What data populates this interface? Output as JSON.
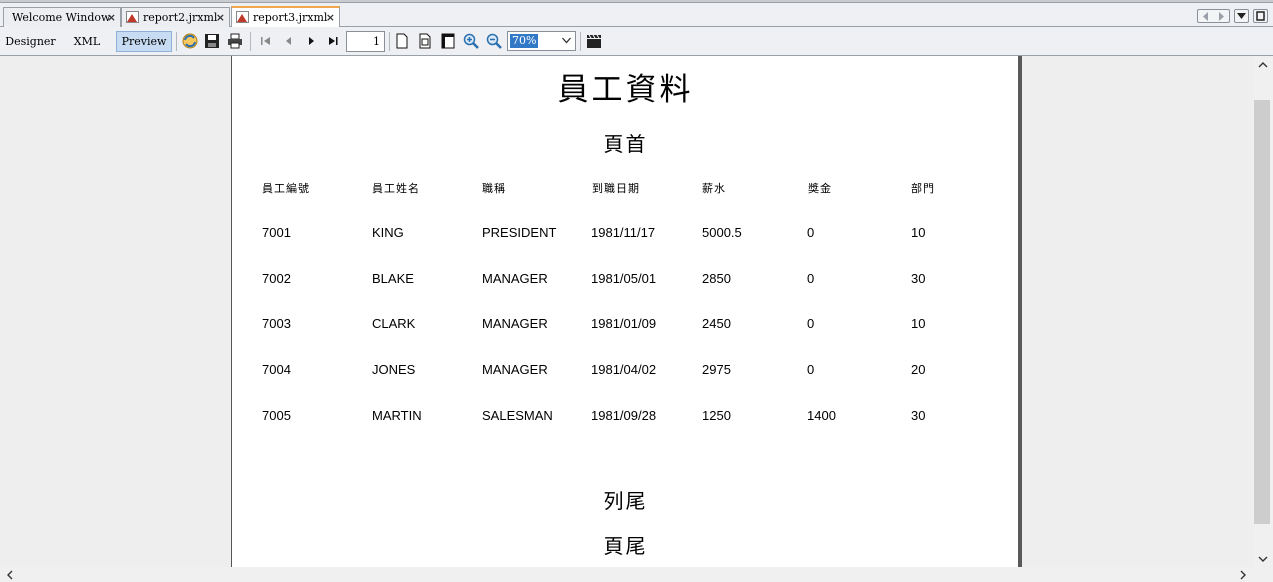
{
  "tabs": [
    {
      "label": "Welcome Window",
      "active": false,
      "has_icon": false
    },
    {
      "label": "report2.jrxml",
      "active": false,
      "has_icon": true
    },
    {
      "label": "report3.jrxml",
      "active": true,
      "has_icon": true
    }
  ],
  "tab_close_glyph": "×",
  "toolbar": {
    "modes": [
      "Designer",
      "XML",
      "Preview"
    ],
    "active_mode": "Preview",
    "page_number": "1",
    "zoom": "70%",
    "icons": [
      "refresh-icon",
      "save-icon",
      "print-icon",
      "first-page-icon",
      "previous-page-icon",
      "next-page-icon",
      "last-page-icon",
      "actual-size-icon",
      "fit-page-icon",
      "fit-width-icon",
      "zoom-in-icon",
      "zoom-out-icon",
      "clapper-icon"
    ]
  },
  "report": {
    "title": "員工資料",
    "page_header": "頁首",
    "column_headers": [
      "員工編號",
      "員工姓名",
      "職稱",
      "到職日期",
      "薪水",
      "獎金",
      "部門"
    ],
    "rows": [
      [
        "7001",
        "KING",
        "PRESIDENT",
        "1981/11/17",
        "5000.5",
        "0",
        "10"
      ],
      [
        "7002",
        "BLAKE",
        "MANAGER",
        "1981/05/01",
        "2850",
        "0",
        "30"
      ],
      [
        "7003",
        "CLARK",
        "MANAGER",
        "1981/01/09",
        "2450",
        "0",
        "10"
      ],
      [
        "7004",
        "JONES",
        "MANAGER",
        "1981/04/02",
        "2975",
        "0",
        "20"
      ],
      [
        "7005",
        "MARTIN",
        "SALESMAN",
        "1981/09/28",
        "1250",
        "1400",
        "30"
      ]
    ],
    "column_footer": "列尾",
    "page_footer": "頁尾"
  },
  "colors": {
    "accent_tab": "#f0a64a",
    "active_mode_bg": "#c7dcf3",
    "zoom_highlight": "#3178c6"
  }
}
